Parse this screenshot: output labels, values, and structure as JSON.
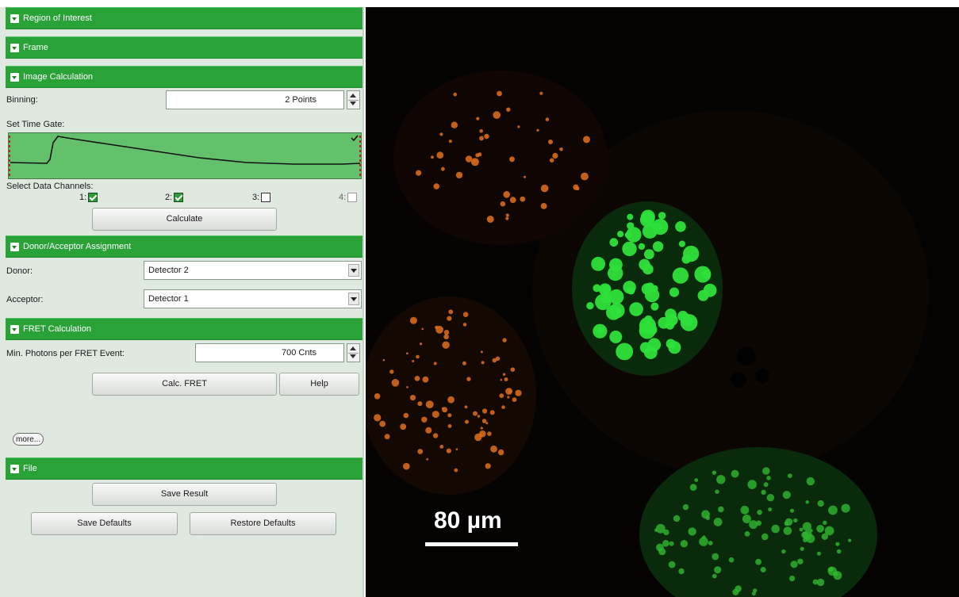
{
  "sections": {
    "roi": "Region of Interest",
    "frame": "Frame",
    "image_calc": "Image Calculation",
    "donor_acceptor": "Donor/Acceptor Assignment",
    "fret_calc": "FRET Calculation",
    "file": "File"
  },
  "image_calc": {
    "binning_label": "Binning:",
    "binning_value": "2 Points",
    "time_gate_label": "Set Time Gate:",
    "channels_label": "Select Data Channels:",
    "channels": [
      {
        "label": "1:",
        "checked": true,
        "enabled": true
      },
      {
        "label": "2:",
        "checked": true,
        "enabled": true
      },
      {
        "label": "3:",
        "checked": false,
        "enabled": true
      },
      {
        "label": "4:",
        "checked": false,
        "enabled": false
      }
    ],
    "calculate_button": "Calculate"
  },
  "donor_acceptor": {
    "donor_label": "Donor:",
    "donor_value": "Detector 2",
    "acceptor_label": "Acceptor:",
    "acceptor_value": "Detector 1"
  },
  "fret": {
    "min_photons_label": "Min. Photons per FRET Event:",
    "min_photons_value": "700 Cnts",
    "calc_button": "Calc. FRET",
    "help_button": "Help",
    "more_button": "more..."
  },
  "file": {
    "save_result": "Save Result",
    "save_defaults": "Save Defaults",
    "restore_defaults": "Restore Defaults"
  },
  "image": {
    "scale_label": "80 µm"
  },
  "colors": {
    "header_green": "#29a337",
    "panel_bg": "#dfe9df",
    "gate_fill": "#63c06b"
  },
  "icons": {
    "section_toggle": "collapse-toggle-icon",
    "spinner": "spinner-arrows-icon",
    "dropdown": "dropdown-arrow-icon"
  }
}
